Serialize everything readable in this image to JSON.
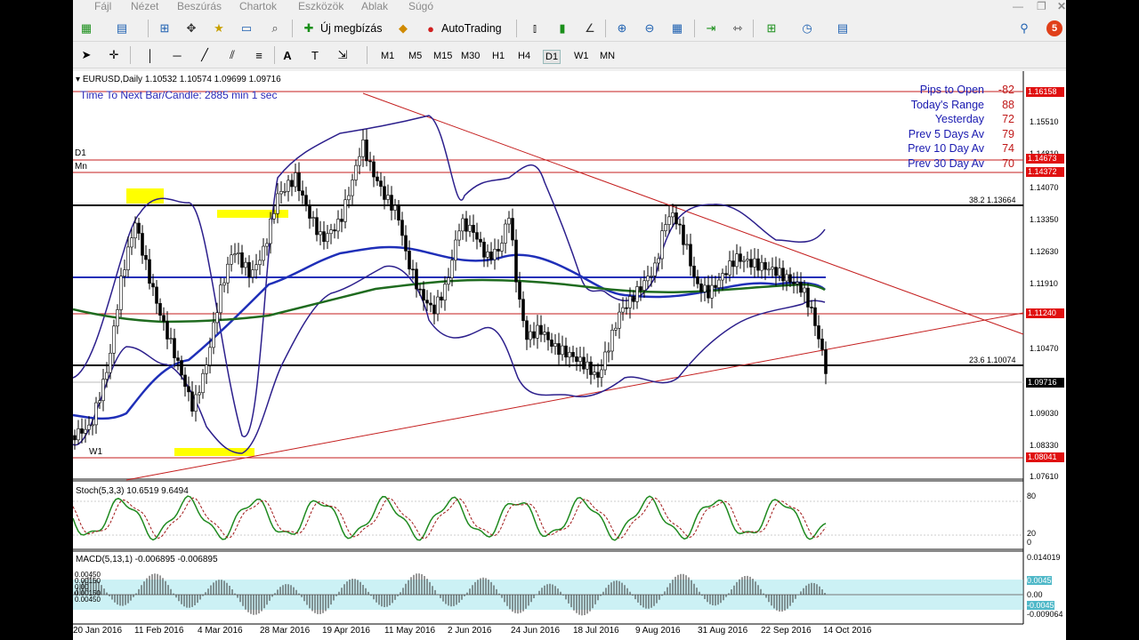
{
  "menu": {
    "items": [
      "Fájl",
      "Nézet",
      "Beszúrás",
      "Chartok",
      "Eszközök",
      "Ablak",
      "Súgó"
    ]
  },
  "toolbar": {
    "new_order_label": "Új megbízás",
    "autotrading_label": "AutoTrading",
    "notification_count": "5",
    "timeframes": [
      "M1",
      "M5",
      "M15",
      "M30",
      "H1",
      "H4",
      "D1",
      "W1",
      "MN"
    ],
    "active_timeframe": "D1"
  },
  "chart": {
    "symbol_header": "EURUSD,Daily  1.10532 1.10574 1.09699 1.09716",
    "timer_text": "Time To Next Bar/Candle: 2885 min 1 sec",
    "label_d1": "D1",
    "label_mn": "Mn",
    "label_w1": "W1",
    "fib_382": "38.2 1.13664",
    "fib_236": "23.6 1.10074",
    "price_scale": [
      "1.15510",
      "1.14810",
      "1.14070",
      "1.13350",
      "1.12630",
      "1.11910",
      "1.10470",
      "1.09030",
      "1.08330",
      "1.07610"
    ],
    "price_boxes": [
      {
        "text": "1.16158",
        "style": "red"
      },
      {
        "text": "1.14673",
        "style": "red"
      },
      {
        "text": "1.14372",
        "style": "red"
      },
      {
        "text": "1.11240",
        "style": "red"
      },
      {
        "text": "1.09716",
        "style": "dark"
      },
      {
        "text": "1.08041",
        "style": "red"
      }
    ],
    "info_panel": [
      {
        "label": "Pips to Open",
        "value": "-82"
      },
      {
        "label": "Today's Range",
        "value": "88"
      },
      {
        "label": "Yesterday",
        "value": "72"
      },
      {
        "label": "Prev 5 Days Av",
        "value": "79"
      },
      {
        "label": "Prev 10 Day Av",
        "value": "74"
      },
      {
        "label": "Prev 30 Day Av",
        "value": "70"
      }
    ],
    "stoch_header": "Stoch(5,3,3) 10.6519 9.6494",
    "stoch_scale": [
      "80",
      "20",
      "0"
    ],
    "macd_header": "MACD(5,13,1) -0.006895 -0.006895",
    "macd_scale": [
      "0.014019",
      "0.0045",
      "0.00",
      "-0.0045",
      "-0.009064"
    ],
    "macd_levels": [
      "0.00450",
      "0.00150",
      "0.00",
      "0.00150",
      "0.00450"
    ],
    "dates": [
      "20 Jan 2016",
      "11 Feb 2016",
      "4 Mar 2016",
      "28 Mar 2016",
      "19 Apr 2016",
      "11 May 2016",
      "2 Jun 2016",
      "24 Jun 2016",
      "18 Jul 2016",
      "9 Aug 2016",
      "31 Aug 2016",
      "22 Sep 2016",
      "14 Oct 2016"
    ]
  },
  "colors": {
    "resistance_line": "#c41e1e",
    "bollinger": "#2c1f8c",
    "ma_blue": "#1f2fb8",
    "ma_green": "#1f6b1f",
    "stoch_main": "#1f8a1f",
    "stoch_signal": "#a01818",
    "highlight": "#ffff00",
    "macd_band": "#8fdfe8"
  }
}
